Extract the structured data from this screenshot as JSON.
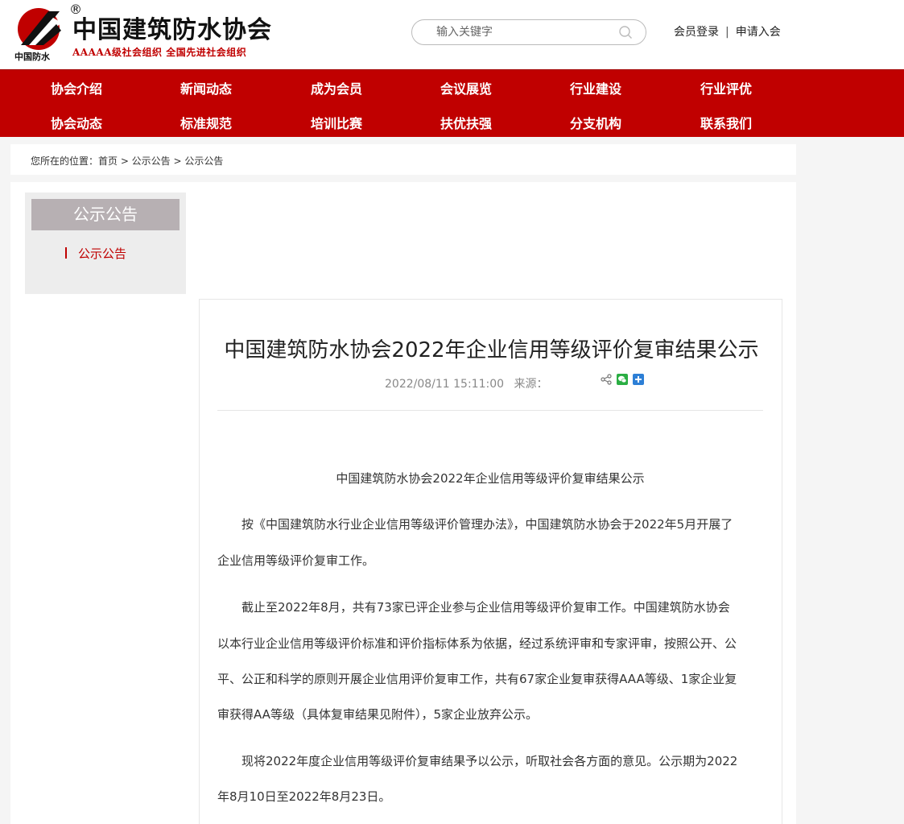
{
  "header": {
    "logo_title": "中国建筑防水协会",
    "logo_reg": "®",
    "logo_mark_text": "中国防水",
    "slogan": "AAAAA级社会组织  全国先进社会组织",
    "search_placeholder": "输入关键字",
    "member_login": "会员登录",
    "separator": "|",
    "join": "申请入会"
  },
  "nav": {
    "row1": [
      "协会介绍",
      "新闻动态",
      "成为会员",
      "会议展览",
      "行业建设",
      "行业评优"
    ],
    "row2": [
      "协会动态",
      "标准规范",
      "培训比赛",
      "扶优扶强",
      "分支机构",
      "联系我们"
    ]
  },
  "breadcrumb": "您所在的位置：首页 > 公示公告 > 公示公告",
  "sidebar": {
    "title": "公示公告",
    "items": [
      "公示公告"
    ]
  },
  "article": {
    "title": "中国建筑防水协会2022年企业信用等级评价复审结果公示",
    "datetime": "2022/08/11 15:11:00",
    "source_label": "来源：",
    "body_title": "中国建筑防水协会2022年企业信用等级评价复审结果公示",
    "lines": [
      "　　按《中国建筑防水行业企业信用等级评价管理办法》，中国建筑防水协会于2022年5月开展了",
      "企业信用等级评价复审工作。",
      "　　截止至2022年8月，共有73家已评企业参与企业信用等级评价复审工作。中国建筑防水协会",
      "以本行业企业信用等级评价标准和评价指标体系为依据，经过系统评审和专家评审，按照公开、公",
      "平、公正和科学的原则开展企业信用评价复审工作，共有67家企业复审获得AAA等级、1家企业复",
      "审获得AA等级（具体复审结果见附件），5家企业放弃公示。",
      "　　现将2022年度企业信用等级评价复审结果予以公示，听取社会各方面的意见。公示期为2022",
      "年8月10日至2022年8月23日。"
    ]
  },
  "colors": {
    "brand_red": "#c00000",
    "sidebar_title_bg": "#b7b0b3"
  },
  "icons": [
    "logo-mark-icon",
    "search-icon",
    "share-icon",
    "wechat-icon",
    "add-more-icon"
  ]
}
